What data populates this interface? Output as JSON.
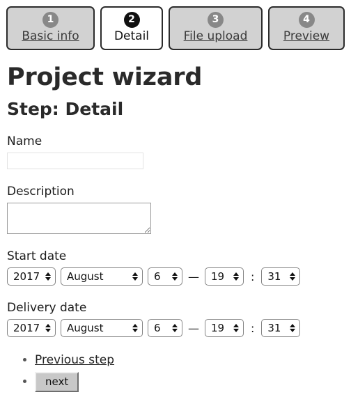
{
  "wizard": {
    "steps": [
      {
        "number": "1",
        "label": "Basic info",
        "active": false
      },
      {
        "number": "2",
        "label": "Detail",
        "active": true
      },
      {
        "number": "3",
        "label": "File upload",
        "active": false
      },
      {
        "number": "4",
        "label": "Preview",
        "active": false
      }
    ]
  },
  "header": {
    "title": "Project wizard",
    "subtitle": "Step: Detail"
  },
  "form": {
    "name": {
      "label": "Name",
      "value": "",
      "placeholder": ""
    },
    "description": {
      "label": "Description",
      "value": "",
      "placeholder": ""
    },
    "start_date": {
      "label": "Start date",
      "year": "2017",
      "month": "August",
      "day": "6",
      "hour": "19",
      "minute": "31"
    },
    "delivery_date": {
      "label": "Delivery date",
      "year": "2017",
      "month": "August",
      "day": "6",
      "hour": "19",
      "minute": "31"
    },
    "separators": {
      "date_time": "—",
      "time": ":"
    }
  },
  "nav": {
    "previous_label": "Previous step",
    "next_label": "next"
  },
  "colors": {
    "tab_inactive_bg": "#d2d2d2",
    "tab_active_bg": "#ffffff",
    "badge_inactive_bg": "#888888",
    "badge_active_bg": "#101010",
    "button_bg": "#c8c8c8",
    "text": "#1a1a1a"
  }
}
